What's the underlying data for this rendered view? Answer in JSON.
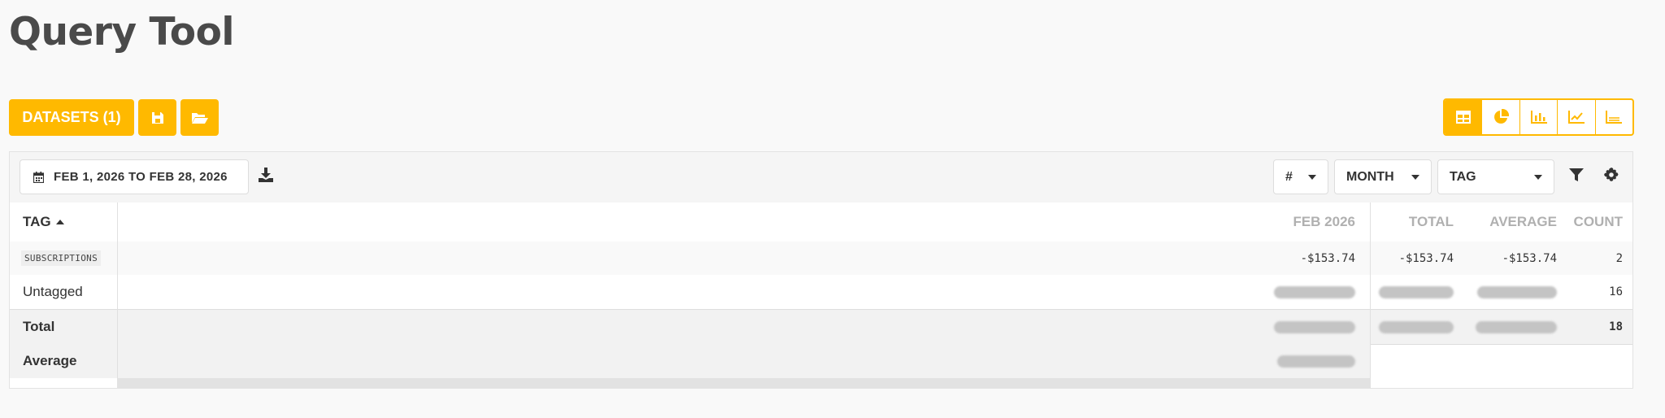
{
  "page": {
    "title": "Query Tool"
  },
  "toolbar": {
    "datasets_label": "DATASETS (1)",
    "save_icon": "save-icon",
    "open_icon": "folder-open-icon"
  },
  "views": [
    {
      "name": "table-icon",
      "active": true
    },
    {
      "name": "pie-chart-icon",
      "active": false
    },
    {
      "name": "bar-chart-icon",
      "active": false
    },
    {
      "name": "line-chart-icon",
      "active": false
    },
    {
      "name": "area-chart-icon",
      "active": false
    }
  ],
  "filters": {
    "date_range": "FEB 1, 2026 TO FEB 28, 2026",
    "metric": "#",
    "period": "MONTH",
    "group_by": "TAG"
  },
  "table": {
    "headers": {
      "tag": "TAG",
      "month": "FEB 2026",
      "total": "TOTAL",
      "average": "AVERAGE",
      "count": "COUNT"
    },
    "rows": [
      {
        "tag": "SUBSCRIPTIONS",
        "month": "-$153.74",
        "total": "-$153.74",
        "average": "-$153.74",
        "count": "2"
      },
      {
        "tag": "Untagged",
        "month": "",
        "total": "",
        "average": "",
        "count": "16"
      }
    ],
    "total_row": {
      "label": "Total",
      "count": "18"
    },
    "average_row": {
      "label": "Average"
    }
  },
  "colors": {
    "accent": "#ffb900",
    "hidden_value_green": "#2ecc40"
  }
}
